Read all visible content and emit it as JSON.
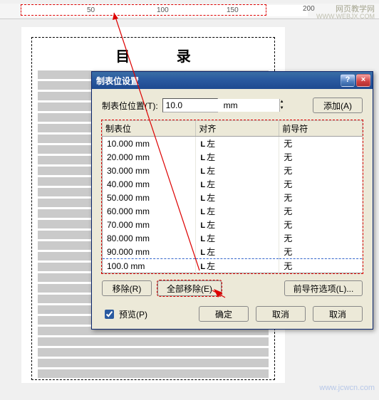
{
  "ruler": {
    "marks": [
      "50",
      "100",
      "150",
      "200"
    ]
  },
  "watermark_top_title": "网页教学网",
  "watermark_top_url": "WWW.WEBJX.COM",
  "watermark_bottom": "www.jcwcn.com",
  "document": {
    "title": "目 录"
  },
  "dialog": {
    "title": "制表位设置",
    "close_glyph": "×",
    "help_glyph": "?",
    "pos_label": "制表位位置(T):",
    "pos_value": "10.0",
    "unit": "mm",
    "add_label": "添加(A)",
    "columns": {
      "pos": "制表位",
      "align": "对齐",
      "leader": "前导符"
    },
    "align_left": "左",
    "leader_none": "无",
    "rows": [
      {
        "pos": "10.000 mm",
        "selected": false
      },
      {
        "pos": "20.000 mm",
        "selected": false
      },
      {
        "pos": "30.000 mm",
        "selected": false
      },
      {
        "pos": "40.000 mm",
        "selected": false
      },
      {
        "pos": "50.000 mm",
        "selected": false
      },
      {
        "pos": "60.000 mm",
        "selected": false
      },
      {
        "pos": "70.000 mm",
        "selected": false
      },
      {
        "pos": "80.000 mm",
        "selected": false
      },
      {
        "pos": "90.000 mm",
        "selected": false
      },
      {
        "pos": "100.0 mm",
        "selected": true
      }
    ],
    "remove_label": "移除(R)",
    "remove_all_label": "全部移除(E)",
    "leader_options_label": "前导符选项(L)...",
    "preview_label": "预览(P)",
    "ok_label": "确定",
    "cancel_label": "取消",
    "cancel2_label": "取消"
  }
}
